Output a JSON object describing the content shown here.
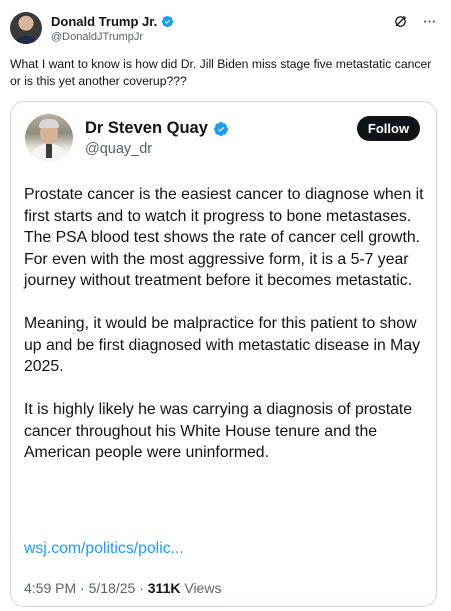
{
  "post": {
    "author": {
      "display_name": "Donald Trump Jr.",
      "handle": "@DonaldJTrumpJr",
      "verified_color": "#1d9bf0"
    },
    "text": "What I want to know is how did Dr. Jill Biden miss stage five metastatic cancer or is this yet another coverup???",
    "icons": [
      "grok-icon",
      "more-icon"
    ]
  },
  "quote": {
    "author": {
      "display_name": "Dr Steven Quay",
      "handle": "@quay_dr"
    },
    "follow_label": "Follow",
    "paragraphs": [
      "Prostate cancer is the easiest cancer to diagnose when it first starts and to watch it progress to bone metastases. The PSA blood test shows the rate of cancer cell growth. For even with the most aggressive form, it is a 5-7 year journey without treatment before it becomes metastatic.",
      "Meaning, it would be malpractice for this patient to show up and be first diagnosed with metastatic disease in May 2025.",
      "It is highly likely he was carrying a diagnosis of prostate cancer throughout his White House tenure and the American people were uninformed."
    ],
    "link": "wsj.com/politics/polic...",
    "meta": {
      "time": "4:59 PM",
      "date": "5/18/25",
      "views_count": "311K",
      "views_label": "Views",
      "separator": "·"
    }
  },
  "colors": {
    "link": "#1d9bf0",
    "secondary_text": "#536471",
    "primary_text": "#0f1419",
    "border": "#cfd9de"
  }
}
